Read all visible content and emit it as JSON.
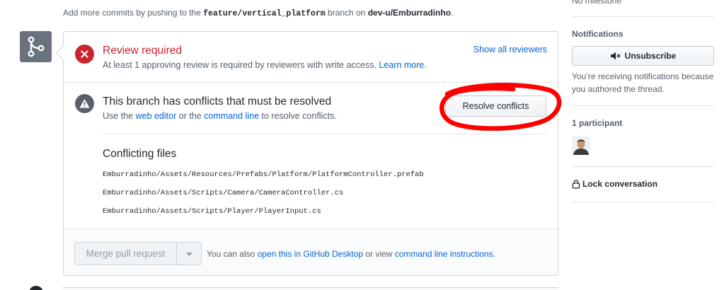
{
  "top_note": {
    "prefix": "Add more commits by pushing to the",
    "branch": "feature/vertical_platform",
    "middle": "branch on",
    "repo": "dev-u/Emburradinho",
    "suffix": "."
  },
  "review": {
    "title": "Review required",
    "description": "At least 1 approving review is required by reviewers with write access.",
    "learn_more": "Learn more.",
    "show_all": "Show all reviewers"
  },
  "conflicts": {
    "title": "This branch has conflicts that must be resolved",
    "desc_prefix": "Use the",
    "web_editor": "web editor",
    "desc_middle": "or the",
    "command_line": "command line",
    "desc_suffix": "to resolve conflicts.",
    "resolve_button": "Resolve conflicts",
    "files_title": "Conflicting files",
    "files": [
      "Emburradinho/Assets/Resources/Prefabs/Platform/PlatformController.prefab",
      "Emburradinho/Assets/Scripts/Camera/CameraController.cs",
      "Emburradinho/Assets/Scripts/Player/PlayerInput.cs"
    ]
  },
  "merge": {
    "button": "Merge pull request",
    "note_prefix": "You can also",
    "desktop_link": "open this in GitHub Desktop",
    "note_middle": "or view",
    "instructions_link": "command line instructions",
    "note_suffix": "."
  },
  "sidebar": {
    "milestone": "No milestone",
    "notifications_heading": "Notifications",
    "unsubscribe": "Unsubscribe",
    "notify_reason": "You’re receiving notifications because you authored the thread.",
    "participants_heading": "1 participant",
    "lock": "Lock conversation"
  },
  "colors": {
    "link": "#0366d6",
    "error": "#cb2431",
    "annotation": "#ff0000",
    "merge_icon_bg": "#6a737d"
  },
  "icons": {
    "merge": "git-merge-icon",
    "review": "x-circle-icon",
    "conflict": "alert-icon",
    "caret": "triangle-down-icon",
    "mute": "mute-icon",
    "lock": "lock-icon"
  }
}
